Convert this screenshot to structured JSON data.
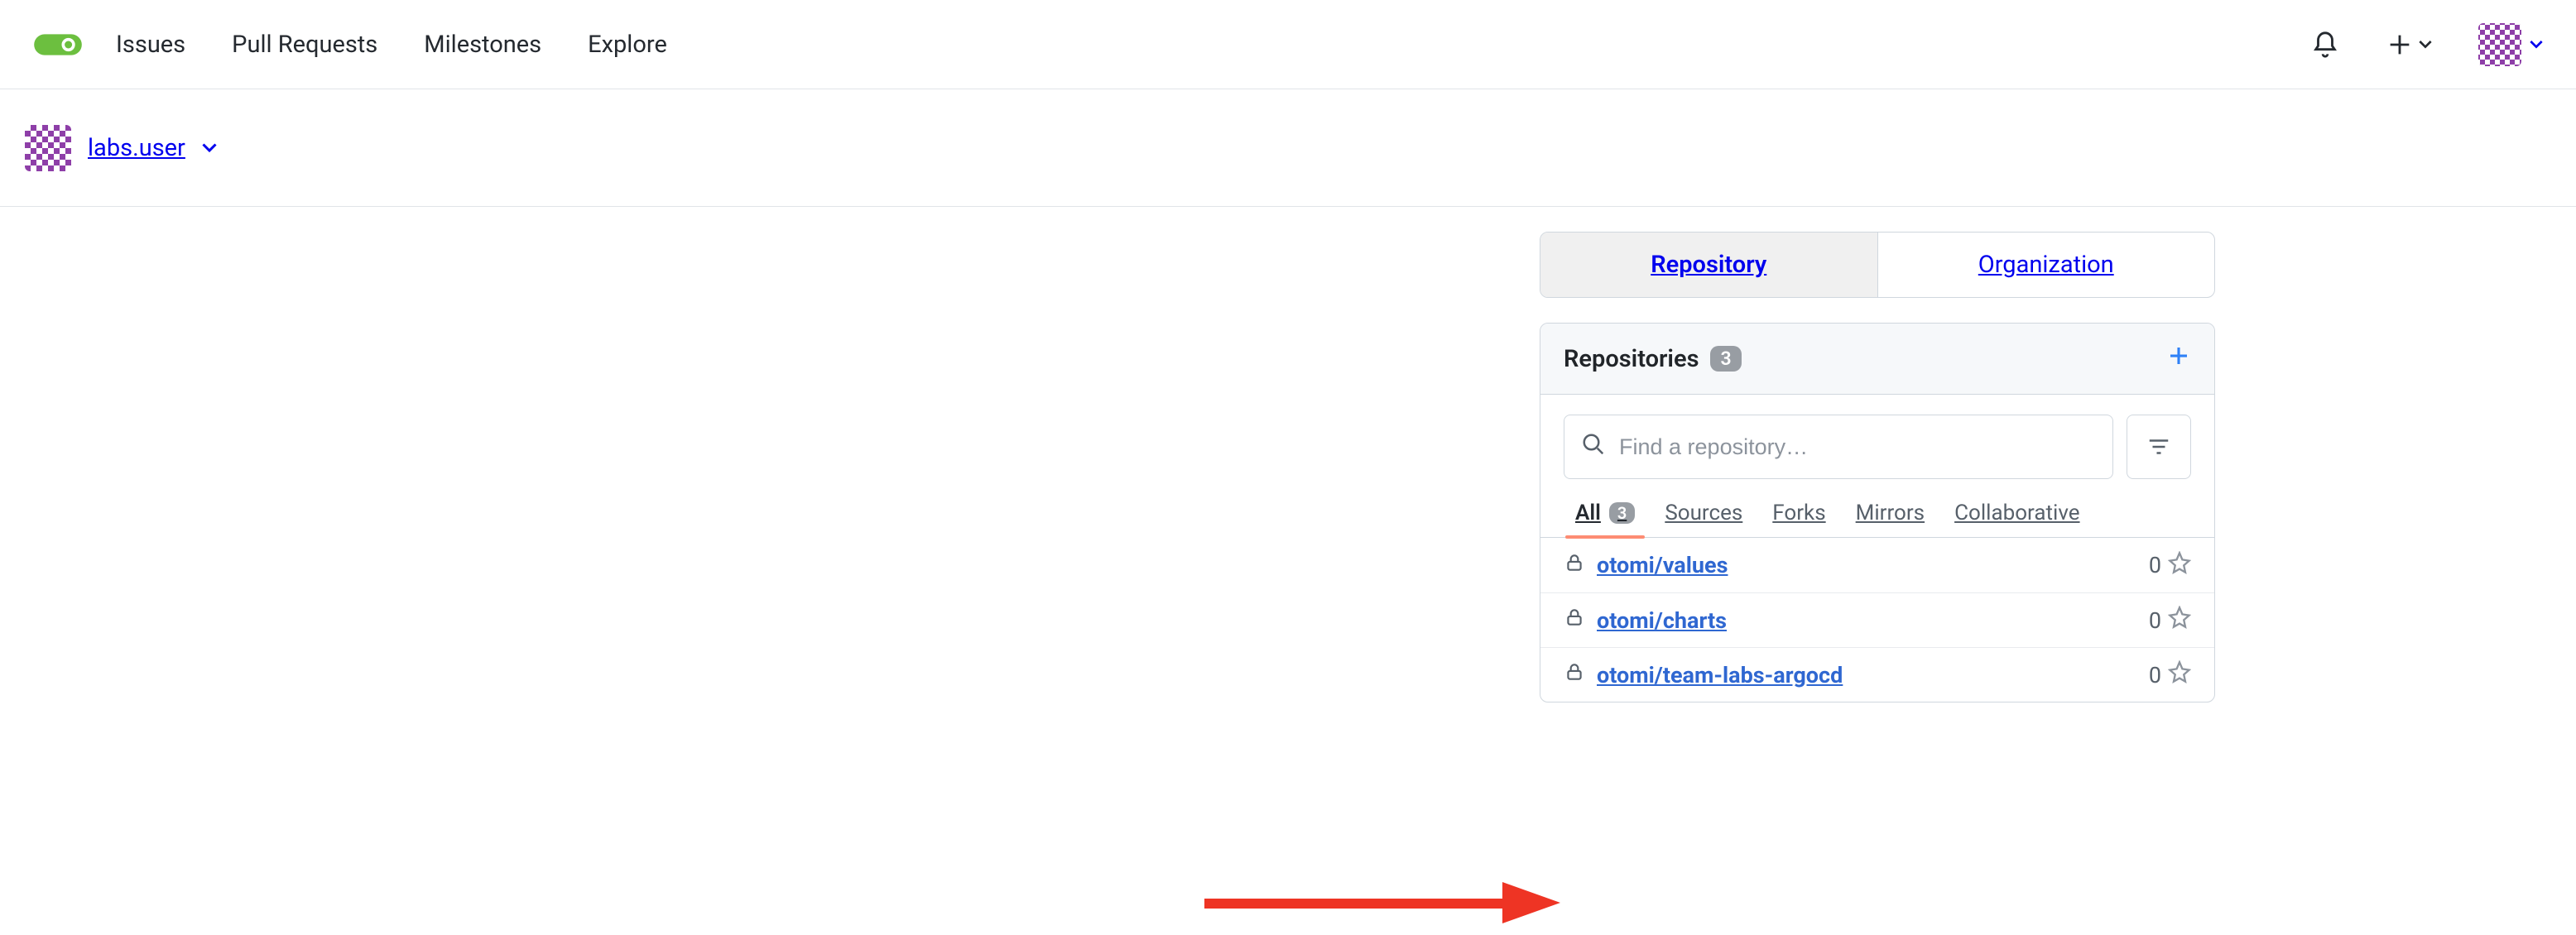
{
  "nav": {
    "issues": "Issues",
    "pull_requests": "Pull Requests",
    "milestones": "Milestones",
    "explore": "Explore"
  },
  "context": {
    "user_name": "labs.user"
  },
  "tabs": {
    "repository": "Repository",
    "organization": "Organization"
  },
  "repos_panel": {
    "title": "Repositories",
    "count": "3",
    "search_placeholder": "Find a repository…",
    "filter_tabs": {
      "all": "All",
      "all_count": "3",
      "sources": "Sources",
      "forks": "Forks",
      "mirrors": "Mirrors",
      "collaborative": "Collaborative"
    },
    "items": [
      {
        "name": "otomi/values",
        "stars": "0"
      },
      {
        "name": "otomi/charts",
        "stars": "0"
      },
      {
        "name": "otomi/team-labs-argocd",
        "stars": "0"
      }
    ]
  }
}
